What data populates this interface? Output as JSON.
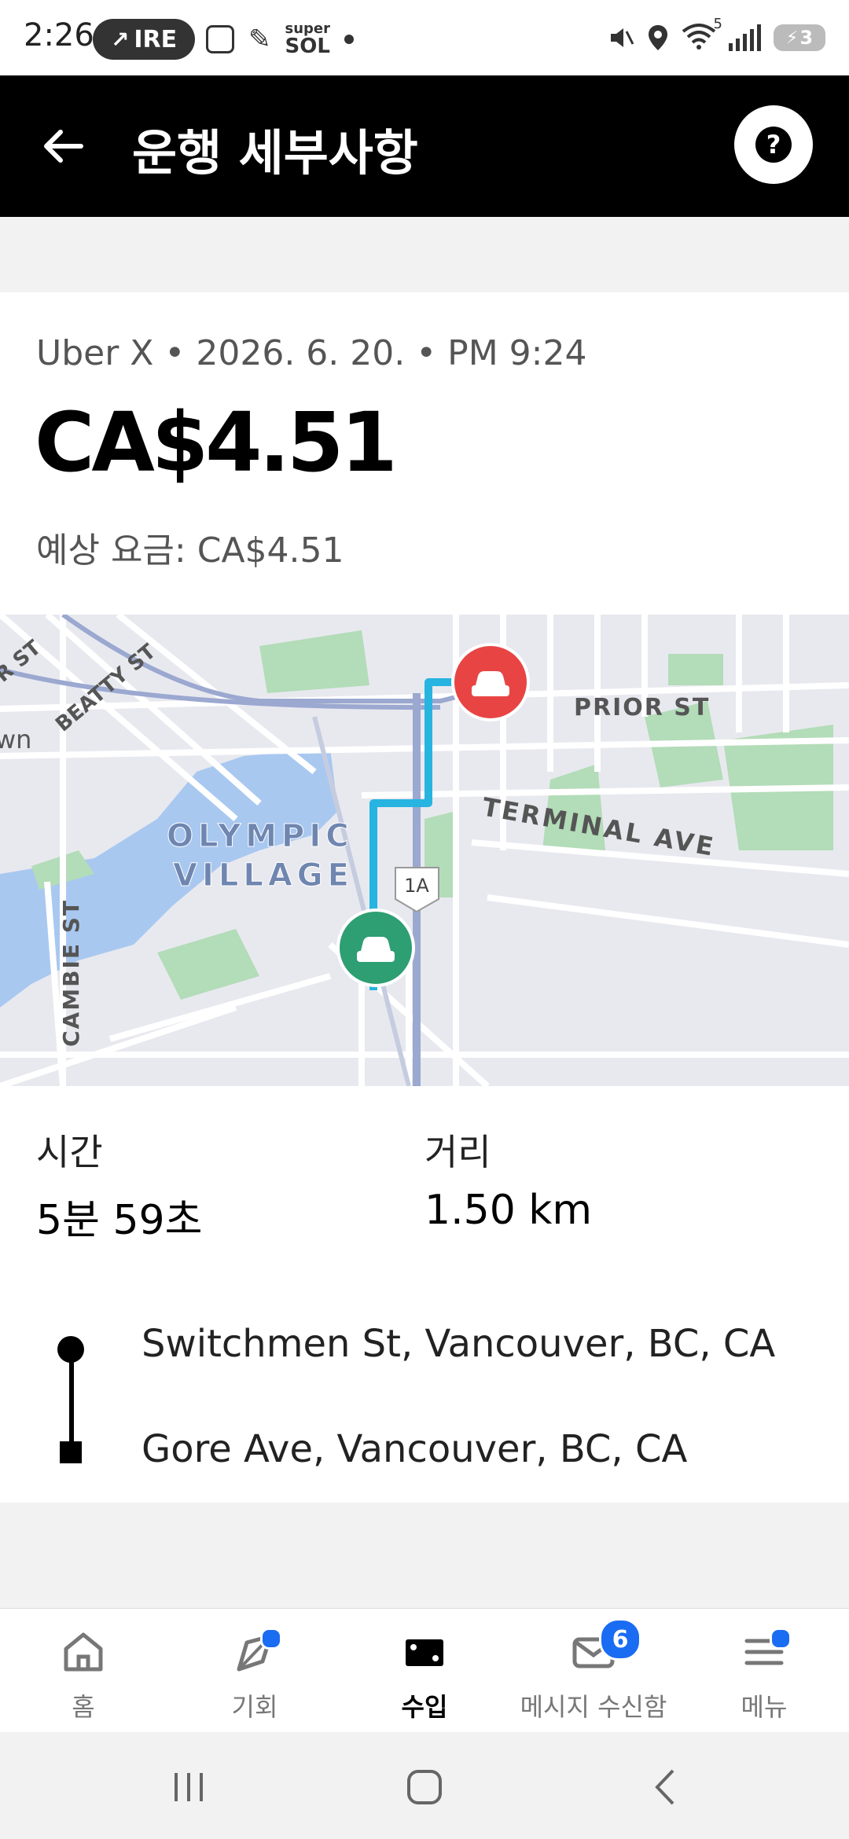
{
  "status_bar": {
    "time": "2:26",
    "pill_label": "IRE",
    "super_sol_top": "super",
    "super_sol_bottom": "SOL",
    "wifi_badge": "5",
    "battery": "3"
  },
  "header": {
    "title": "운행 세부사항"
  },
  "trip": {
    "meta": "Uber X • 2026. 6. 20. • PM 9:24",
    "fare": "CA$4.51",
    "estimated_fare": "예상 요금: CA$4.51"
  },
  "map": {
    "labels": {
      "r_st": "R ST",
      "beatty_st": "BEATTY ST",
      "wn": "wn",
      "prior_st": "PRIOR ST",
      "cambie_st": "CAMBIE ST",
      "highway_1a": "1A",
      "terminal_ave": "TERMINAL AVE",
      "olympic": "OLYMPIC",
      "village": "VILLAGE"
    },
    "colors": {
      "route": "#27b4e0",
      "pickup": "#2e9e73",
      "dropoff": "#e84444",
      "water": "#a9c8f0",
      "park": "#b3dcb8"
    }
  },
  "stats": {
    "time_label": "시간",
    "time_value": "5분 59초",
    "distance_label": "거리",
    "distance_value": "1.50 km"
  },
  "route": {
    "start": "Switchmen St, Vancouver, BC, CA",
    "end": "Gore Ave, Vancouver, BC, CA"
  },
  "nav": {
    "home": "홈",
    "opportunities": "기회",
    "earnings": "수입",
    "inbox": "메시지 수신함",
    "inbox_badge": "6",
    "menu": "메뉴"
  }
}
